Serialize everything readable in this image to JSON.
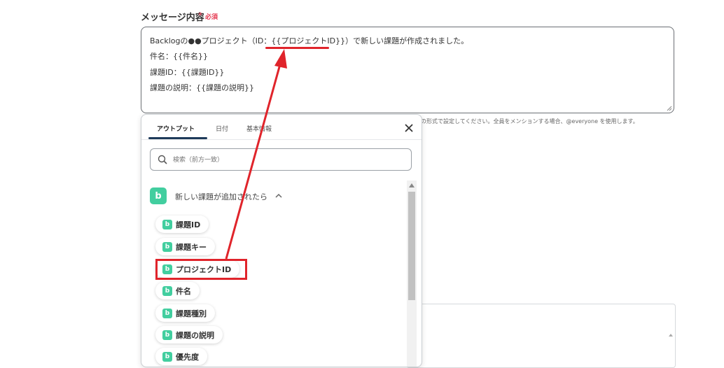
{
  "field": {
    "label": "メッセージ内容",
    "required_star": "*",
    "required_text": "必須"
  },
  "message": {
    "lines": [
      "Backlogの●●プロジェクト（ID：{{プロジェクトID}}）で新しい課題が作成されました。",
      "件名：{{件名}}",
      "課題ID：{{課題ID}}",
      "課題の説明：{{課題の説明}}"
    ]
  },
  "help_text": "の形式で設定してください。全員をメンションする場合、@everyone を使用します。",
  "popup": {
    "tabs": [
      {
        "label": "アウトプット",
        "active": true
      },
      {
        "label": "日付",
        "active": false
      },
      {
        "label": "基本情報",
        "active": false
      }
    ],
    "close_icon": "close-icon",
    "search": {
      "placeholder": "検索（前方一致）",
      "value": ""
    },
    "group": {
      "logo": "b",
      "logo_color": "#42ce9f",
      "title": "新しい課題が追加されたら",
      "expanded": true
    },
    "items": [
      {
        "logo": "b",
        "label": "課題ID"
      },
      {
        "logo": "b",
        "label": "課題キー"
      },
      {
        "logo": "b",
        "label": "プロジェクトID",
        "highlighted": true
      },
      {
        "logo": "b",
        "label": "件名"
      },
      {
        "logo": "b",
        "label": "課題種別"
      },
      {
        "logo": "b",
        "label": "課題の説明"
      },
      {
        "logo": "b",
        "label": "優先度"
      }
    ]
  },
  "annotation": {
    "color": "#e0242b"
  }
}
